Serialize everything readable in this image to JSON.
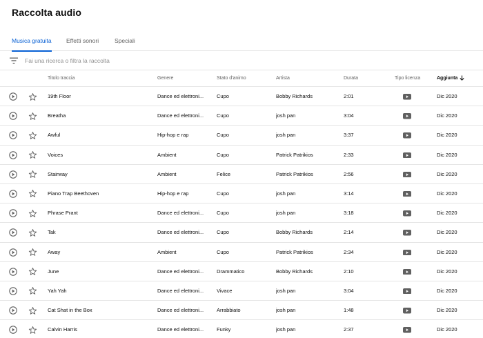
{
  "page": {
    "title": "Raccolta audio"
  },
  "tabs": [
    {
      "label": "Musica gratuita",
      "active": true
    },
    {
      "label": "Effetti sonori",
      "active": false
    },
    {
      "label": "Speciali",
      "active": false
    }
  ],
  "filter": {
    "placeholder": "Fai una ricerca o filtra la raccolta",
    "icon": "filter-icon"
  },
  "table": {
    "headers": {
      "title": "Titolo traccia",
      "genre": "Genere",
      "mood": "Stato d'animo",
      "artist": "Artista",
      "duration": "Durata",
      "license": "Tipo licenza",
      "added": "Aggiunta"
    },
    "sorted_by": "added",
    "sort_direction": "descending",
    "rows": [
      {
        "title": "19th Floor",
        "genre": "Dance ed elettroni...",
        "mood": "Cupo",
        "artist": "Bobby Richards",
        "duration": "2:01",
        "added": "Dic 2020"
      },
      {
        "title": "Breatha",
        "genre": "Dance ed elettroni...",
        "mood": "Cupo",
        "artist": "josh pan",
        "duration": "3:04",
        "added": "Dic 2020"
      },
      {
        "title": "Awful",
        "genre": "Hip-hop e rap",
        "mood": "Cupo",
        "artist": "josh pan",
        "duration": "3:37",
        "added": "Dic 2020"
      },
      {
        "title": "Voices",
        "genre": "Ambient",
        "mood": "Cupo",
        "artist": "Patrick Patrikios",
        "duration": "2:33",
        "added": "Dic 2020"
      },
      {
        "title": "Stairway",
        "genre": "Ambient",
        "mood": "Felice",
        "artist": "Patrick Patrikios",
        "duration": "2:56",
        "added": "Dic 2020"
      },
      {
        "title": "Piano Trap Beethoven",
        "genre": "Hip-hop e rap",
        "mood": "Cupo",
        "artist": "josh pan",
        "duration": "3:14",
        "added": "Dic 2020"
      },
      {
        "title": "Phrase Prant",
        "genre": "Dance ed elettroni...",
        "mood": "Cupo",
        "artist": "josh pan",
        "duration": "3:18",
        "added": "Dic 2020"
      },
      {
        "title": "Tak",
        "genre": "Dance ed elettroni...",
        "mood": "Cupo",
        "artist": "Bobby Richards",
        "duration": "2:14",
        "added": "Dic 2020"
      },
      {
        "title": "Away",
        "genre": "Ambient",
        "mood": "Cupo",
        "artist": "Patrick Patrikios",
        "duration": "2:34",
        "added": "Dic 2020"
      },
      {
        "title": "June",
        "genre": "Dance ed elettroni...",
        "mood": "Drammatico",
        "artist": "Bobby Richards",
        "duration": "2:10",
        "added": "Dic 2020"
      },
      {
        "title": "Yah Yah",
        "genre": "Dance ed elettroni...",
        "mood": "Vivace",
        "artist": "josh pan",
        "duration": "3:04",
        "added": "Dic 2020"
      },
      {
        "title": "Cat Shat in the Box",
        "genre": "Dance ed elettroni...",
        "mood": "Arrabbiato",
        "artist": "josh pan",
        "duration": "1:48",
        "added": "Dic 2020"
      },
      {
        "title": "Calvin Harris",
        "genre": "Dance ed elettroni...",
        "mood": "Funky",
        "artist": "josh pan",
        "duration": "2:37",
        "added": "Dic 2020"
      }
    ],
    "row_icons": {
      "play": "play-circle-icon",
      "favorite": "star-outline-icon",
      "license": "youtube-icon"
    }
  },
  "colors": {
    "accent": "#065fd4",
    "text": "#0d0d0d",
    "muted": "#606060",
    "divider": "#e5e5e5",
    "icon": "#606060"
  }
}
